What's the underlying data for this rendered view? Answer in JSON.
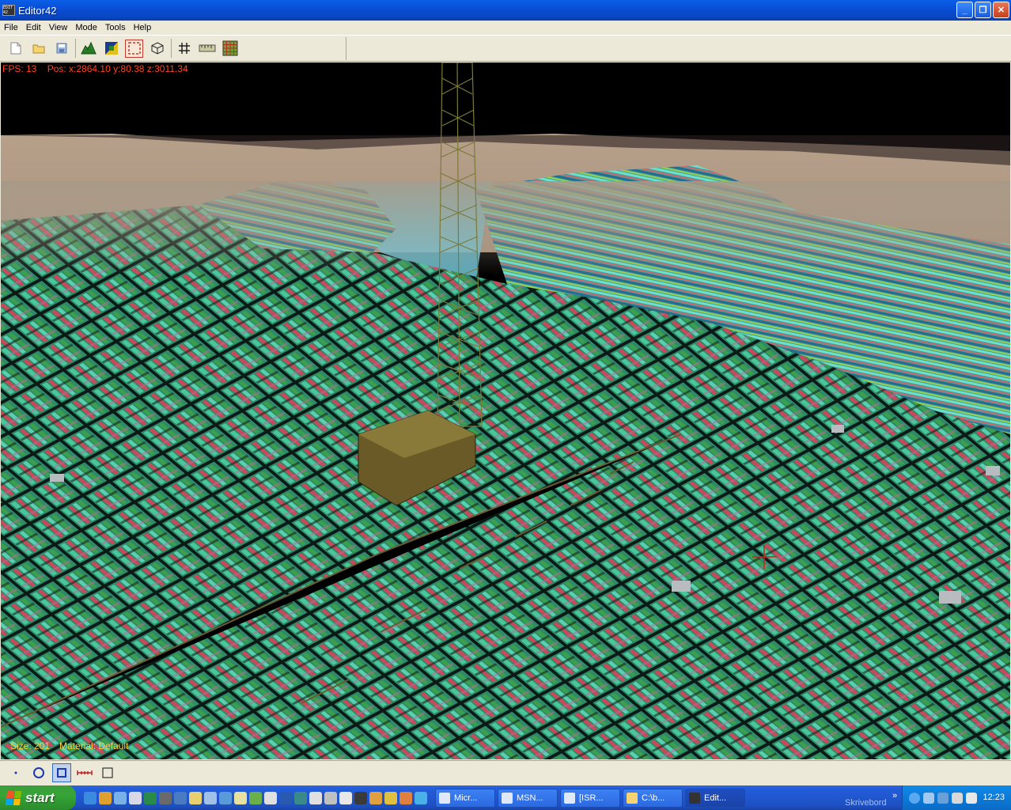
{
  "window": {
    "title": "Editor42",
    "app_icon_text": "EDIT 42",
    "buttons": {
      "minimize": "_",
      "maximize": "❐",
      "close": "✕"
    }
  },
  "menu": [
    "File",
    "Edit",
    "View",
    "Mode",
    "Tools",
    "Help"
  ],
  "toolbar": {
    "icons": [
      "new-file-icon",
      "open-folder-icon",
      "save-icon",
      "terrain-icon",
      "texture-paint-icon",
      "selection-icon",
      "cube-icon",
      "grid-icon",
      "ruler-icon",
      "tile-grid-icon"
    ]
  },
  "viewport": {
    "fps_label": "FPS: 13",
    "pos_label": "Pos: x:2864.10  y:80.38  z:3011.34",
    "size_label": "Size: 201",
    "material_label": "Material: Default"
  },
  "bottom_tools": [
    "point-brush-icon",
    "circle-brush-icon",
    "square-brush-icon",
    "measure-icon",
    "empty-square-icon"
  ],
  "taskbar": {
    "start_label": "start",
    "tasks": [
      {
        "label": "Micr...",
        "active": false
      },
      {
        "label": "MSN...",
        "active": false
      },
      {
        "label": "[ISR...",
        "active": false
      },
      {
        "label": "C:\\b...",
        "active": false
      },
      {
        "label": "Edit...",
        "active": true
      }
    ],
    "desktop_label": "Skrivebord",
    "clock": "12:23",
    "colors": {
      "start_green": "#36a536",
      "taskbar_blue": "#245edb",
      "tray_blue": "#0c7ad8"
    }
  }
}
